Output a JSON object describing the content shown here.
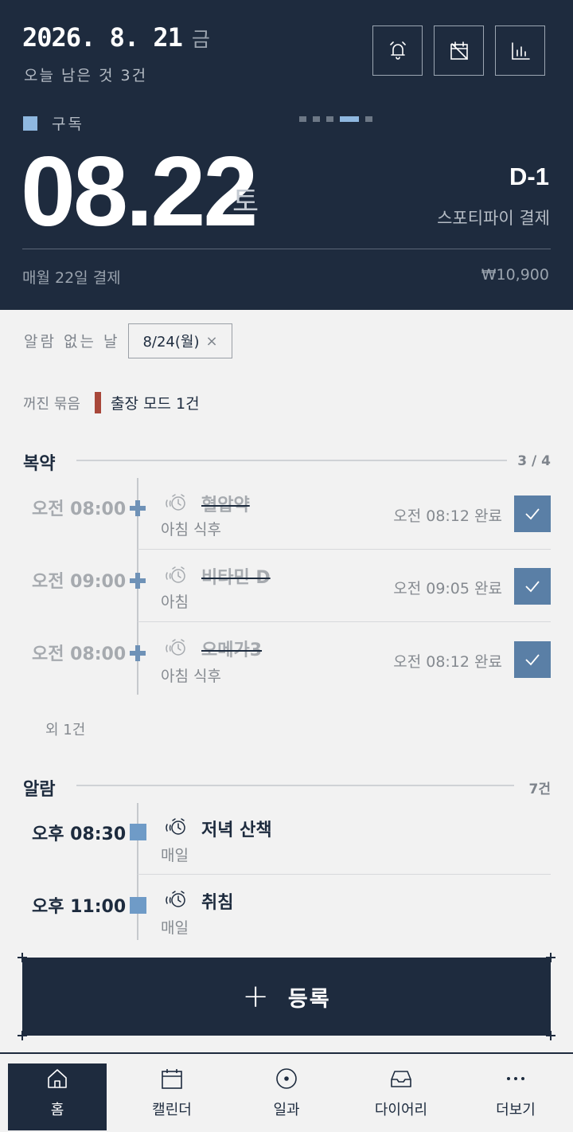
{
  "header": {
    "date": "2026. 8. 21",
    "weekday": "금",
    "remaining": "오늘 남은 것 3건",
    "buttons": [
      {
        "name": "alarm-bell-icon"
      },
      {
        "name": "calendar-off-icon"
      },
      {
        "name": "bar-chart-icon"
      }
    ],
    "subscription_label": "구독",
    "pager": {
      "count": 5,
      "active_index": 3
    },
    "card": {
      "date": "08.22",
      "weekday": "토",
      "dday": "D-1",
      "service": "스포티파이 결제",
      "pay_day": "매월 22일 결제",
      "amount": "₩10,900"
    }
  },
  "no_alarm": {
    "label": "알람 없는 날",
    "chip": "8/24(월)",
    "chip_close": "×"
  },
  "off_group": {
    "label": "꺼진 묶음",
    "value": "출장 모드 1건",
    "color": "#a8473a"
  },
  "medication": {
    "title": "복약",
    "count": "3 / 4",
    "items": [
      {
        "time": "오전 08:00",
        "name": "혈압약",
        "sub": "아침 식후",
        "done": "오전 08:12 완료"
      },
      {
        "time": "오전 09:00",
        "name": "비타민 D",
        "sub": "아침",
        "done": "오전 09:05 완료"
      },
      {
        "time": "오전 08:00",
        "name": "오메가3",
        "sub": "아침 식후",
        "done": "오전 08:12 완료"
      }
    ],
    "more": "외 1건"
  },
  "alarms": {
    "title": "알람",
    "count": "7건",
    "items": [
      {
        "time": "오후 08:30",
        "name": "저녁 산책",
        "sub": "매일"
      },
      {
        "time": "오후 11:00",
        "name": "취침",
        "sub": "매일"
      }
    ]
  },
  "register": {
    "icon": "+",
    "label": "등록"
  },
  "nav": [
    {
      "label": "홈",
      "icon": "home-icon",
      "active": true
    },
    {
      "label": "캘린더",
      "icon": "calendar-icon",
      "active": false
    },
    {
      "label": "일과",
      "icon": "routine-circle-icon",
      "active": false
    },
    {
      "label": "다이어리",
      "icon": "inbox-icon",
      "active": false
    },
    {
      "label": "더보기",
      "icon": "more-dots-icon",
      "active": false
    }
  ],
  "colors": {
    "navy": "#1e2b3e",
    "accent": "#8fb8e0",
    "check": "#5a7fa6",
    "node": "#6f92b7"
  }
}
